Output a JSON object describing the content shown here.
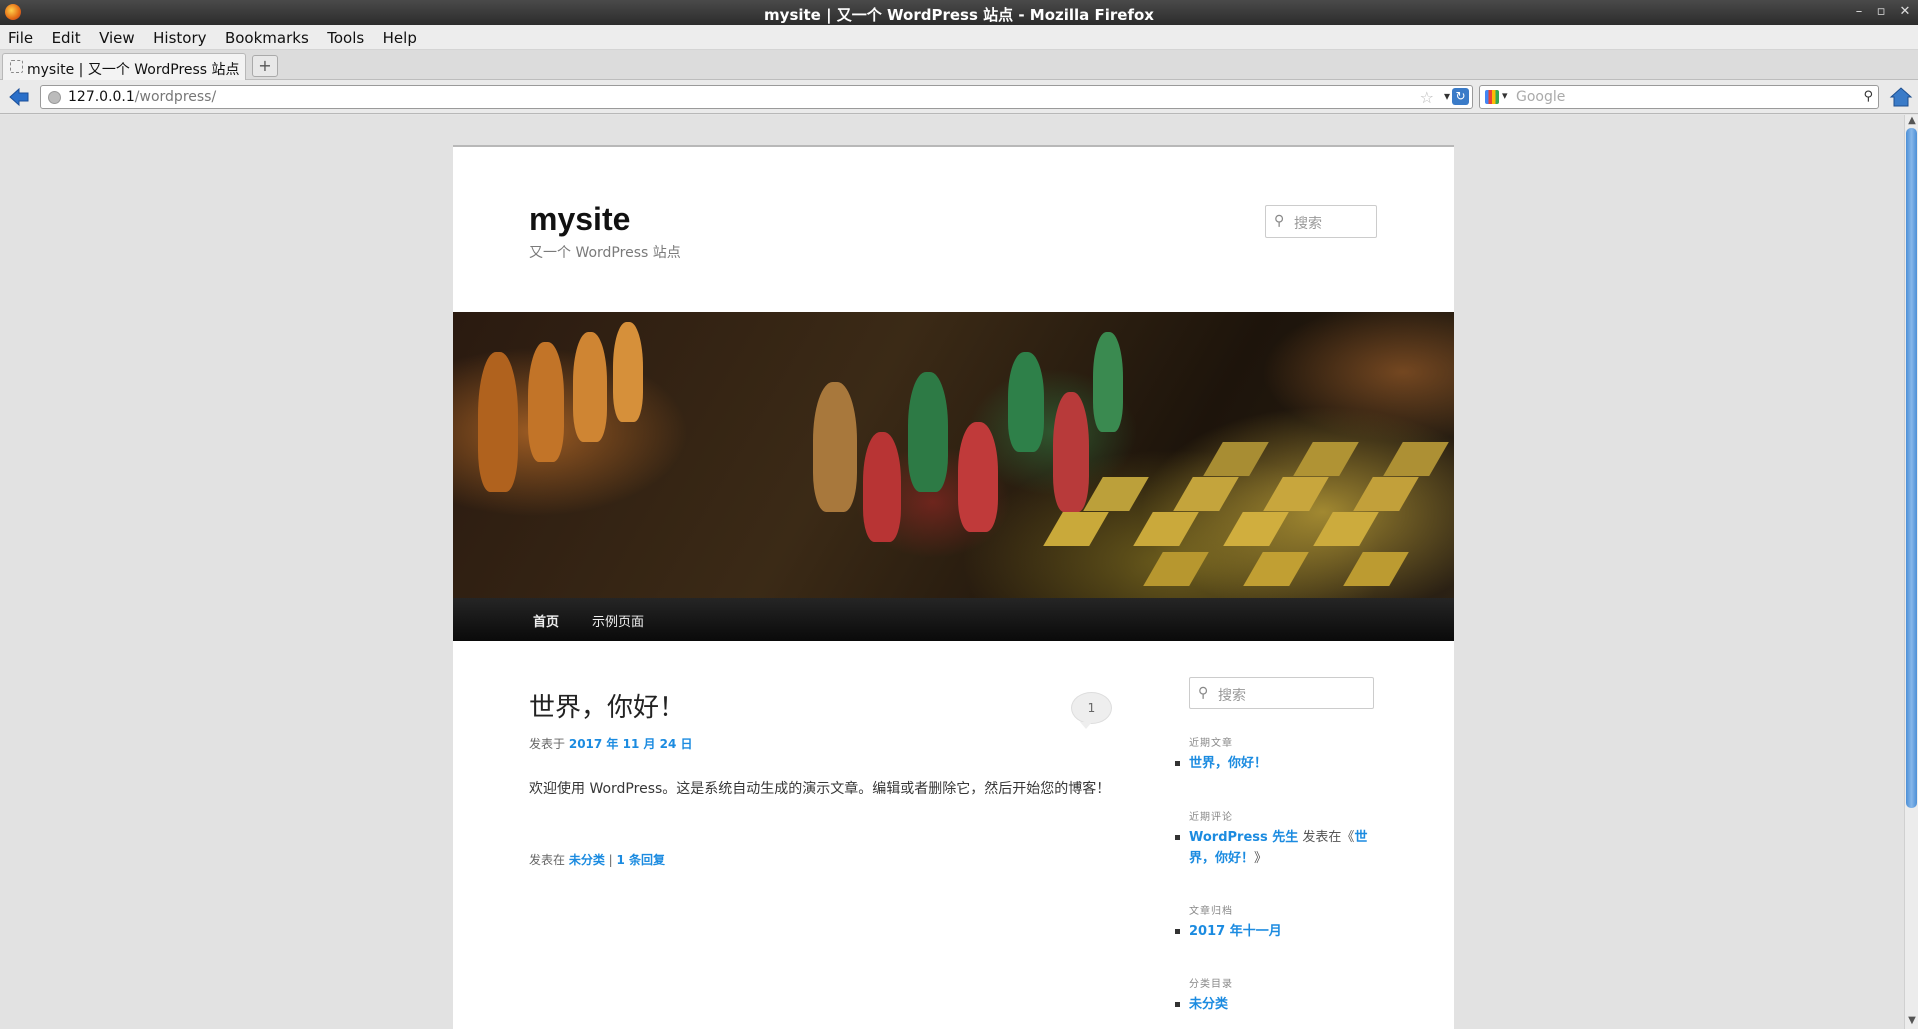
{
  "window": {
    "title": "mysite | 又一个 WordPress 站点 - Mozilla Firefox",
    "buttons": [
      "–",
      "▫",
      "✕"
    ]
  },
  "menu": [
    "File",
    "Edit",
    "View",
    "History",
    "Bookmarks",
    "Tools",
    "Help"
  ],
  "tab": {
    "label": "mysite | 又一个 WordPress 站点",
    "new_tab_symbol": "+"
  },
  "address": {
    "host": "127.0.0.1",
    "path": "/wordpress/"
  },
  "search_engine": {
    "placeholder": "Google"
  },
  "site": {
    "title": "mysite",
    "description": "又一个 WordPress 站点",
    "header_search_placeholder": "搜索"
  },
  "nav": {
    "items": [
      "首页",
      "示例页面"
    ]
  },
  "post": {
    "title": "世界，你好！",
    "comment_count": "1",
    "meta_prefix": "发表于",
    "date": "2017 年 11 月 24 日",
    "content": "欢迎使用 WordPress。这是系统自动生成的演示文章。编辑或者删除它，然后开始您的博客！",
    "footer_prefix": "发表在",
    "category": "未分类",
    "separator": " | ",
    "replies": "1 条回复"
  },
  "sidebar": {
    "search_placeholder": "搜索",
    "recent_posts_title": "近期文章",
    "recent_posts": [
      "世界，你好！"
    ],
    "recent_comments_title": "近期评论",
    "recent_comment": {
      "author": "WordPress 先生",
      "mid": " 发表在《",
      "post": "世界，你好！",
      "end": "》"
    },
    "archives_title": "文章归档",
    "archives": [
      "2017 年十一月"
    ],
    "categories_title": "分类目录",
    "categories": [
      "未分类"
    ]
  },
  "icons": {
    "back": "back-arrow-icon",
    "reload": "reload-icon",
    "home": "home-icon",
    "search": "magnifier-icon"
  },
  "colors": {
    "link": "#1b8be0",
    "nav_bg": "#111111",
    "scroll_thumb": "#4c8fd6"
  }
}
